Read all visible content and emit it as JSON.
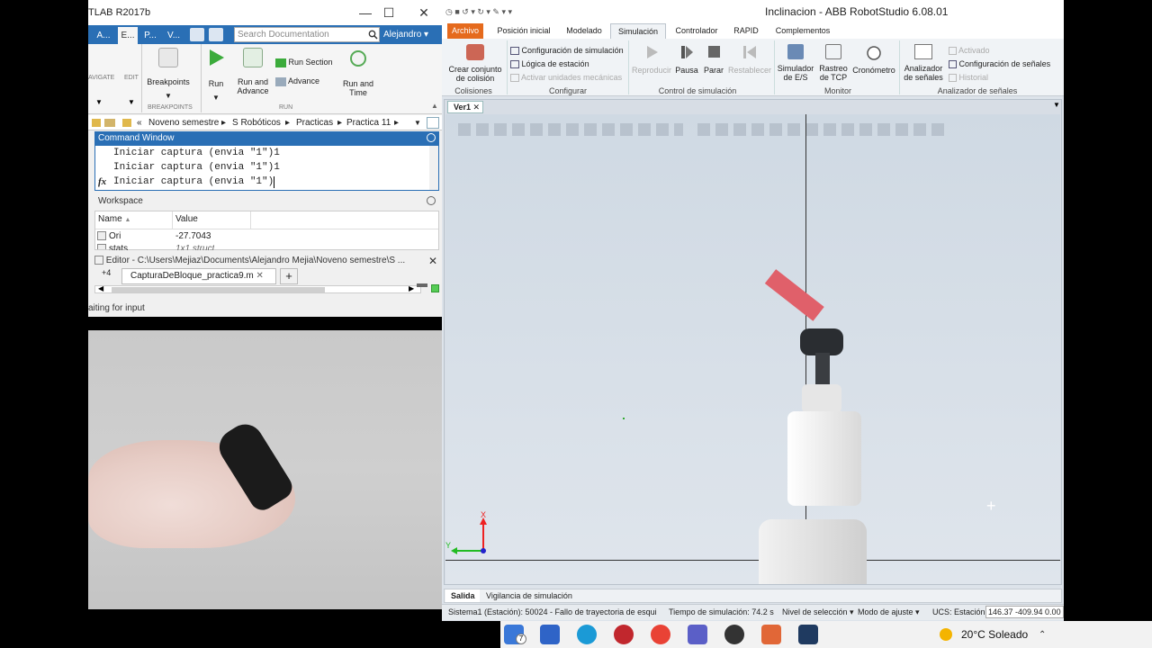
{
  "matlab": {
    "title": "TLAB R2017b",
    "tabs": [
      "A...",
      "E...",
      "P...",
      "V..."
    ],
    "search_placeholder": "Search Documentation",
    "user": "Alejandro",
    "ribbon": {
      "navigate": "AVIGATE",
      "edit": "EDIT",
      "breakpoints": "Breakpoints",
      "run": "Run",
      "run_and_advance": [
        "Run and",
        "Advance"
      ],
      "run_section": "Run Section",
      "advance": "Advance",
      "run_and_time": [
        "Run and",
        "Time"
      ],
      "group_breakpoints": "BREAKPOINTS",
      "group_run": "RUN"
    },
    "path": [
      "Noveno semestre",
      "S Robóticos",
      "Practicas",
      "Practica 11"
    ],
    "command_window": {
      "title": "Command Window",
      "lines": [
        "Iniciar captura (envia \"1\")1",
        "Iniciar captura (envia \"1\")1",
        "Iniciar captura (envia \"1\")"
      ],
      "prompt": "fx"
    },
    "workspace": {
      "title": "Workspace",
      "col_name": "Name",
      "col_value": "Value",
      "rows": [
        {
          "name": "Ori",
          "value": "-27.7043"
        },
        {
          "name": "stats",
          "value": "1x1 struct"
        }
      ]
    },
    "editor": {
      "title": "Editor - C:\\Users\\Mejiaz\\Documents\\Alejandro Mejia\\Noveno semestre\\S ...",
      "tab_count": "+4",
      "file_tab": "CapturaDeBloque_practica9.m",
      "add_tab": "+"
    },
    "status": "aiting for input"
  },
  "robotstudio": {
    "title": "Inclinacion - ABB RobotStudio 6.08.01",
    "menu": [
      "Archivo",
      "Posición inicial",
      "Modelado",
      "Simulación",
      "Controlador",
      "RAPID",
      "Complementos"
    ],
    "active_menu": "Simulación",
    "ribbon": {
      "crear_conjunto": [
        "Crear conjunto",
        "de colisión"
      ],
      "config_sim": "Configuración de simulación",
      "logica": "Lógica de estación",
      "activar": "Activar unidades mecánicas",
      "reproducir": "Reproducir",
      "pausa": "Pausa",
      "parar": "Parar",
      "restablecer": "Restablecer",
      "simulador": [
        "Simulador",
        "de E/S"
      ],
      "rastreo": [
        "Rastreo",
        "de TCP"
      ],
      "cronometro": "Cronómetro",
      "analizador": [
        "Analizador",
        "de señales"
      ],
      "activado": "Activado",
      "config_senales": "Configuración de señales",
      "historial": "Historial",
      "groups": [
        "Colisiones",
        "Configurar",
        "Control de simulación",
        "Monitor",
        "Analizador de señales"
      ]
    },
    "doc_tab": "Ver1",
    "output_tabs": [
      "Salida",
      "Vigilancia de simulación"
    ],
    "status": {
      "message": "Sistema1 (Estación): 50024 - Fallo de trayectoria de esqui",
      "sim_time": "Tiempo de simulación: 74.2 s",
      "selection": "Nivel de selección",
      "snap": "Modo de ajuste",
      "ucs": "UCS: Estación",
      "coords": "146.37  -409.94  0.00"
    },
    "axes": {
      "x": "X",
      "y": "Y"
    }
  },
  "taskbar": {
    "badge": "7",
    "weather": "20°C  Soleado"
  }
}
